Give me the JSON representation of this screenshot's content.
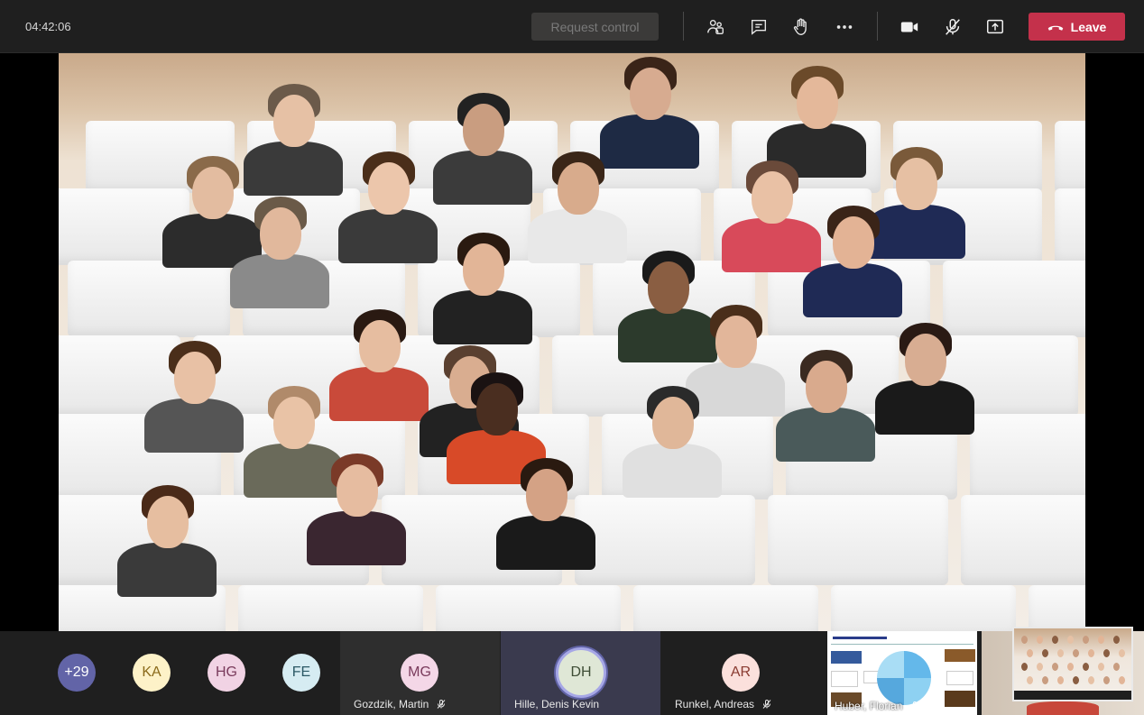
{
  "timer": "04:42:06",
  "toolbar": {
    "request_control_label": "Request control",
    "leave_label": "Leave",
    "leave_color": "#c4314b",
    "icons": [
      "participants-icon",
      "chat-icon",
      "raise-hand-icon",
      "more-options-icon",
      "camera-icon",
      "mic-muted-icon",
      "share-screen-icon"
    ]
  },
  "overflow_count": "+29",
  "avatars": [
    {
      "initials": "KA",
      "bg": "#fdf2c8",
      "fg": "#8a6a1a"
    },
    {
      "initials": "HG",
      "bg": "#f1d3e4",
      "fg": "#7a3b5c"
    },
    {
      "initials": "FE",
      "bg": "#d6ecf2",
      "fg": "#2c5966"
    }
  ],
  "tiles": [
    {
      "initials": "MG",
      "name": "Gozdzik, Martin",
      "bg": "#f4d7e7",
      "fg": "#7a3b5c",
      "muted": true
    },
    {
      "initials": "DH",
      "name": "Hille, Denis Kevin",
      "bg": "#dfe7d6",
      "fg": "#3e4d35",
      "muted": false,
      "speaking": true
    },
    {
      "initials": "AR",
      "name": "Runkel, Andreas",
      "bg": "#fbe0dc",
      "fg": "#8a3b31",
      "muted": true
    }
  ],
  "shared_tile": {
    "name": "Huber, Florian",
    "muted": true
  },
  "overflow_color": "#6264a7"
}
